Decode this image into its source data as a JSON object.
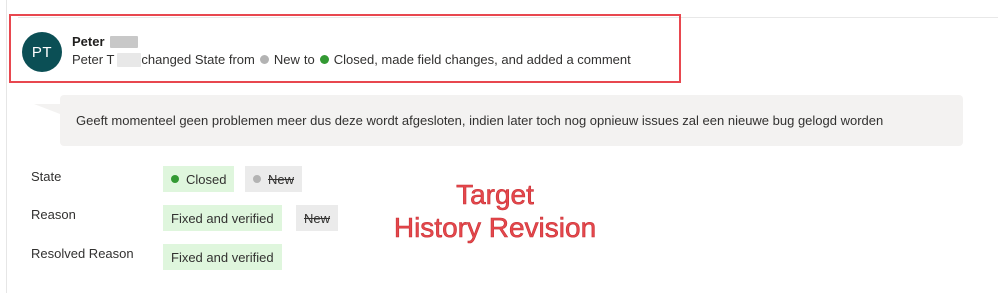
{
  "author": {
    "initials": "PT",
    "name": "Peter",
    "summary_name": "Peter T",
    "summary_action": "changed State from",
    "state_from": "New",
    "summary_to": "to",
    "state_to": "Closed",
    "summary_rest": ", made field changes, and added a comment"
  },
  "comment": {
    "text": "Geeft momenteel geen problemen meer dus deze wordt afgesloten, indien later toch nog opnieuw issues zal een nieuwe bug gelogd worden"
  },
  "fields": [
    {
      "label": "State",
      "new_value": "Closed",
      "old_value": "New"
    },
    {
      "label": "Reason",
      "new_value": "Fixed and verified",
      "old_value": "New"
    },
    {
      "label": "Resolved Reason",
      "new_value": "Fixed and verified"
    }
  ],
  "annotation": {
    "line1": "Target",
    "line2": "History Revision"
  },
  "colors": {
    "avatar_bg": "#0b4f55",
    "state_closed": "#339933",
    "state_new": "#b3b3b3",
    "highlight": "#e8474f",
    "new_value_bg": "#dff6dd",
    "old_value_bg": "#ebebeb"
  }
}
